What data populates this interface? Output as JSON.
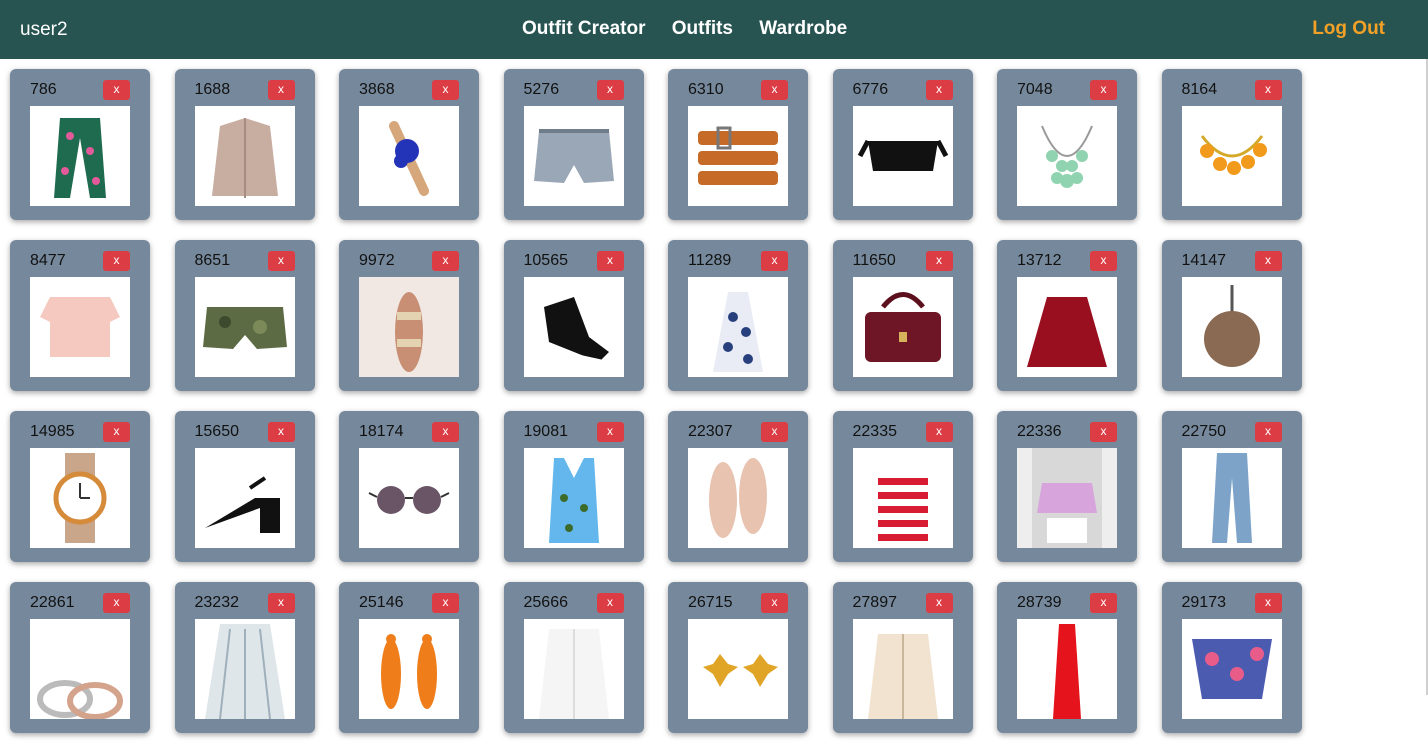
{
  "nav": {
    "user": "user2",
    "links": [
      "Outfit Creator",
      "Outfits",
      "Wardrobe"
    ],
    "logout": "Log Out"
  },
  "delete_label": "x",
  "items": [
    {
      "id": "786",
      "icon": "floral-pants-icon"
    },
    {
      "id": "1688",
      "icon": "blazer-icon"
    },
    {
      "id": "3868",
      "icon": "sandal-icon"
    },
    {
      "id": "5276",
      "icon": "shorts-icon"
    },
    {
      "id": "6310",
      "icon": "belt-icon"
    },
    {
      "id": "6776",
      "icon": "off-shoulder-top-icon"
    },
    {
      "id": "7048",
      "icon": "necklace-icon"
    },
    {
      "id": "8164",
      "icon": "bracelet-icon"
    },
    {
      "id": "8477",
      "icon": "crop-top-icon"
    },
    {
      "id": "8651",
      "icon": "camo-shorts-icon"
    },
    {
      "id": "9972",
      "icon": "bikini-icon"
    },
    {
      "id": "10565",
      "icon": "sneaker-icon"
    },
    {
      "id": "11289",
      "icon": "halter-top-icon"
    },
    {
      "id": "11650",
      "icon": "handbag-icon"
    },
    {
      "id": "13712",
      "icon": "skirt-icon"
    },
    {
      "id": "14147",
      "icon": "fur-keychain-icon"
    },
    {
      "id": "14985",
      "icon": "watch-icon"
    },
    {
      "id": "15650",
      "icon": "heel-icon"
    },
    {
      "id": "18174",
      "icon": "sunglasses-icon"
    },
    {
      "id": "19081",
      "icon": "swimsuit-icon"
    },
    {
      "id": "22307",
      "icon": "oxford-shoes-icon"
    },
    {
      "id": "22335",
      "icon": "striped-tank-icon"
    },
    {
      "id": "22336",
      "icon": "blouse-icon"
    },
    {
      "id": "22750",
      "icon": "jeans-icon"
    },
    {
      "id": "22861",
      "icon": "rings-icon"
    },
    {
      "id": "23232",
      "icon": "pleated-skirt-icon"
    },
    {
      "id": "25146",
      "icon": "earrings-icon"
    },
    {
      "id": "25666",
      "icon": "fur-vest-icon"
    },
    {
      "id": "26715",
      "icon": "star-earrings-icon"
    },
    {
      "id": "27897",
      "icon": "jacket-icon"
    },
    {
      "id": "28739",
      "icon": "red-dress-icon"
    },
    {
      "id": "29173",
      "icon": "floral-bottoms-icon"
    }
  ]
}
